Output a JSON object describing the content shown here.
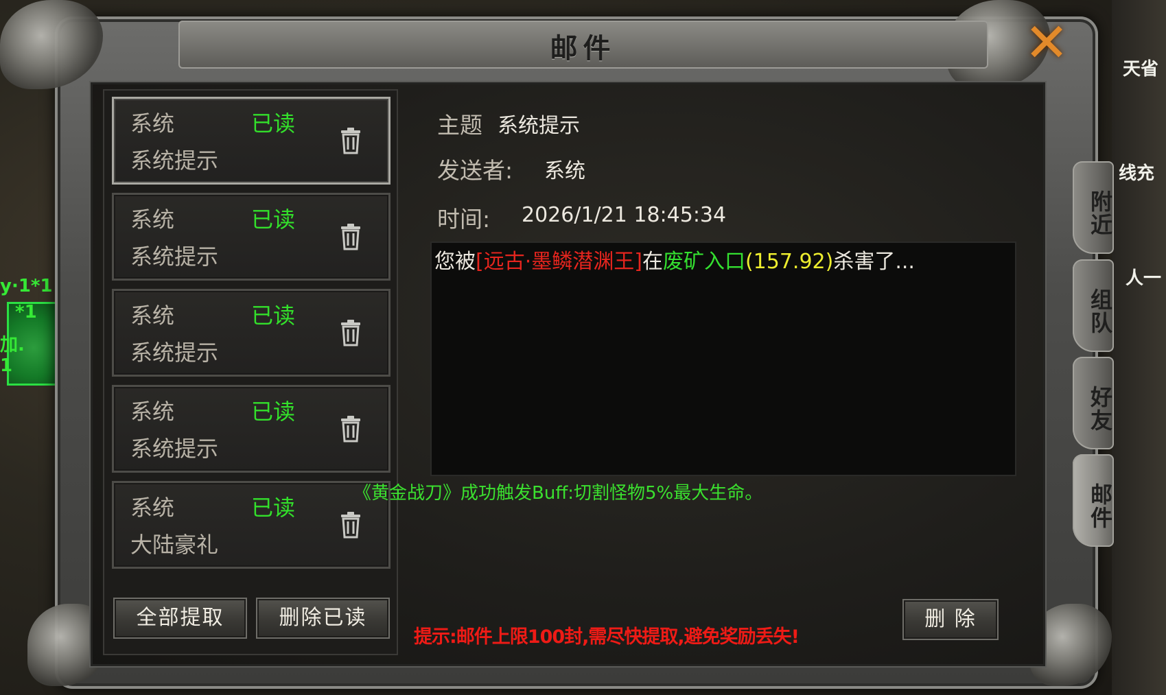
{
  "window": {
    "title": "邮件"
  },
  "mail_list": [
    {
      "sender": "系统",
      "status": "已读",
      "subject": "系统提示",
      "selected": true
    },
    {
      "sender": "系统",
      "status": "已读",
      "subject": "系统提示",
      "selected": false
    },
    {
      "sender": "系统",
      "status": "已读",
      "subject": "系统提示",
      "selected": false
    },
    {
      "sender": "系统",
      "status": "已读",
      "subject": "系统提示",
      "selected": false
    },
    {
      "sender": "系统",
      "status": "已读",
      "subject": "大陆豪礼",
      "selected": false
    }
  ],
  "buttons": {
    "claim_all": "全部提取",
    "delete_read": "删除已读",
    "delete": "删 除"
  },
  "detail": {
    "subject_label": "主题",
    "subject_value": "系统提示",
    "sender_label": "发送者:",
    "sender_value": "系统",
    "time_label": "时间:",
    "time_value": "2026/1/21 18:45:34",
    "message": {
      "prefix": "您被",
      "killer": "[远古·墨鳞潜渊王]",
      "mid": "在",
      "location": "废矿入口",
      "coords": "(157.92)",
      "suffix": "杀害了..."
    }
  },
  "buff_notice": "《黄金战刀》成功触发Buff:切割怪物5%最大生命。",
  "hint": "提示:邮件上限100封,需尽快提取,避免奖励丢失!",
  "side_tabs": [
    {
      "label": "附近",
      "active": false
    },
    {
      "label": "组队",
      "active": false
    },
    {
      "label": "好友",
      "active": false
    },
    {
      "label": "邮件",
      "active": true
    }
  ],
  "hud": {
    "left_text_1": "y·1*1",
    "left_text_2": "*1",
    "left_text_3": "加.",
    "left_text_4": "1",
    "right_text_1": "天省",
    "right_text_2": "线充",
    "right_text_3": "人一"
  },
  "colors": {
    "read_status": "#33e02b",
    "killer_red": "#e5251e",
    "location_green": "#34e030",
    "coords_yellow": "#eded2e",
    "hint_red": "#ee1b16",
    "close_orange": "#e38a2a"
  },
  "icons": {
    "close": "close-icon",
    "trash": "trash-icon"
  }
}
